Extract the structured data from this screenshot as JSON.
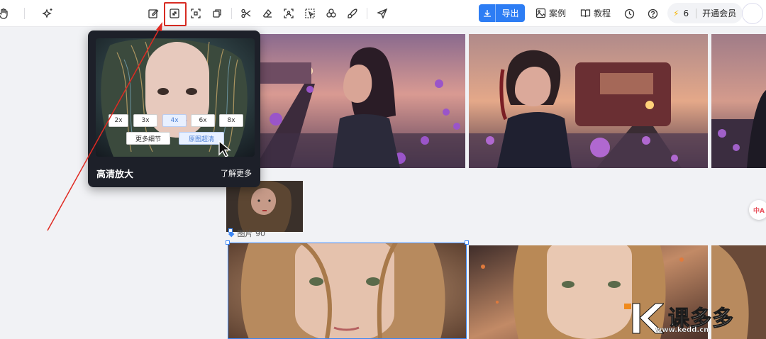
{
  "toolbar": {
    "icons": [
      "hand-icon",
      "magic-sparkle-icon",
      "edit-icon",
      "upscale-expand-icon",
      "expand-frame-icon",
      "redraw-icon",
      "scissors-icon",
      "eraser-icon",
      "cutout-icon",
      "select-icon",
      "shapes-icon",
      "brush-icon",
      "send-icon"
    ],
    "export_label": "导出",
    "cases_label": "案例",
    "tutorial_label": "教程",
    "credits": "6",
    "vip_label": "开通会员"
  },
  "popup": {
    "scales": [
      "2x",
      "3x",
      "4x",
      "6x",
      "8x"
    ],
    "selected_scale": "4x",
    "more_detail_label": "更多细节",
    "original_label": "原图超清",
    "title": "高清放大",
    "learn_more": "了解更多"
  },
  "canvas": {
    "image_label": "图片 90"
  },
  "watermark": {
    "brand": "课多多",
    "url": "www.kedd.cn"
  },
  "colors": {
    "accent": "#2d7df4",
    "highlight": "#d72b22",
    "selection": "#3a86f7"
  }
}
